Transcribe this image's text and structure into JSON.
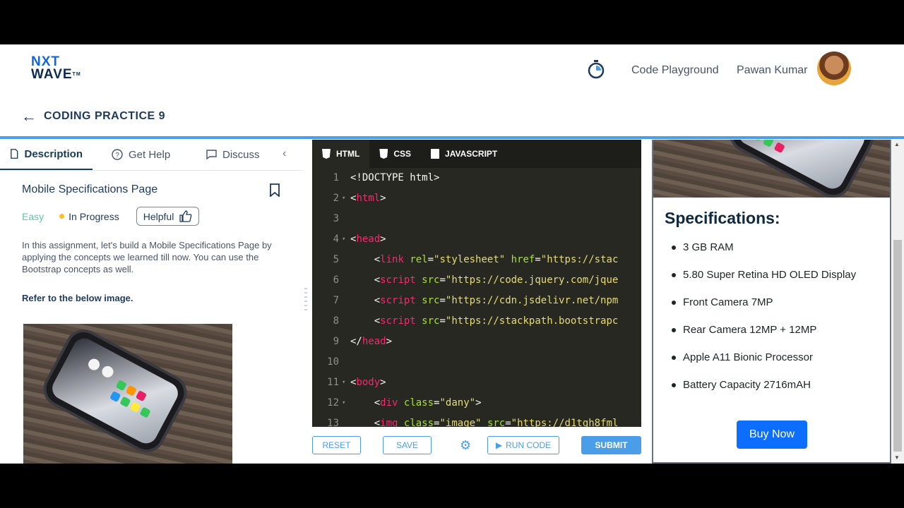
{
  "header": {
    "logo_line1": "NXT",
    "logo_line2": "WAVE",
    "logo_tm": "TM",
    "nav_link": "Code Playground",
    "user_name": "Pawan Kumar",
    "page_title": "CODING PRACTICE 9"
  },
  "left_panel": {
    "tabs": [
      {
        "label": "Description",
        "icon": "description-icon",
        "active": true
      },
      {
        "label": "Get Help",
        "icon": "help-icon",
        "active": false
      },
      {
        "label": "Discuss",
        "icon": "chat-icon",
        "active": false
      }
    ],
    "problem_title": "Mobile Specifications Page",
    "difficulty": "Easy",
    "status": "In Progress",
    "helpful_label": "Helpful",
    "description": "In this assignment, let's build a Mobile Specifications Page by applying the concepts we learned till now. You can use the Bootstrap concepts as well.",
    "refer_text": "Refer to the below image."
  },
  "editor": {
    "tabs": [
      {
        "label": "HTML",
        "active": true
      },
      {
        "label": "CSS",
        "active": false
      },
      {
        "label": "JAVASCRIPT",
        "active": false
      }
    ],
    "lines": [
      {
        "num": "1",
        "fold": false,
        "code": "<!DOCTYPE html>"
      },
      {
        "num": "2",
        "fold": true,
        "code": "<html>"
      },
      {
        "num": "3",
        "fold": false,
        "code": ""
      },
      {
        "num": "4",
        "fold": true,
        "code": "<head>"
      },
      {
        "num": "5",
        "fold": false,
        "code": "    <link rel=\"stylesheet\" href=\"https://stac"
      },
      {
        "num": "6",
        "fold": false,
        "code": "    <script src=\"https://code.jquery.com/jque"
      },
      {
        "num": "7",
        "fold": false,
        "code": "    <script src=\"https://cdn.jsdelivr.net/npm"
      },
      {
        "num": "8",
        "fold": false,
        "code": "    <script src=\"https://stackpath.bootstrapc"
      },
      {
        "num": "9",
        "fold": false,
        "code": "</head>"
      },
      {
        "num": "10",
        "fold": false,
        "code": ""
      },
      {
        "num": "11",
        "fold": true,
        "code": "<body>"
      },
      {
        "num": "12",
        "fold": true,
        "code": "    <div class=\"dany\">"
      },
      {
        "num": "13",
        "fold": false,
        "code": "    <img class=\"image\" src=\"https://d1tgh8fml"
      }
    ],
    "toolbar": {
      "reset": "RESET",
      "save": "SAVE",
      "run": "RUN CODE",
      "submit": "SUBMIT"
    }
  },
  "preview": {
    "spec_title": "Specifications:",
    "specs": [
      "3 GB RAM",
      "5.80 Super Retina HD OLED Display",
      "Front Camera 7MP",
      "Rear Camera 12MP + 12MP",
      "Apple A11 Bionic Processor",
      "Battery Capacity 2716mAH"
    ],
    "buy_button": "Buy Now"
  },
  "colors": {
    "accent": "#4a9ee8",
    "brand_dark": "#1e3a5f",
    "easy_green": "#5bc8a0",
    "progress_yellow": "#fbbf24",
    "buy_blue": "#0d6efd",
    "editor_bg": "#272822"
  }
}
